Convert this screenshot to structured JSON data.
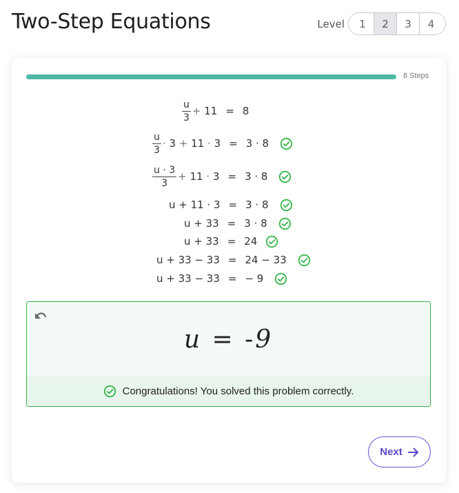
{
  "header": {
    "title": "Two-Step Equations",
    "level_label": "Level",
    "levels": [
      "1",
      "2",
      "3",
      "4"
    ],
    "selected_level": "2"
  },
  "progress": {
    "fraction": 1.0,
    "label": "8 Steps",
    "color": "#4fb8a6"
  },
  "steps": [
    {
      "lhs": "u/3 + 11",
      "rhs": "8",
      "checked": false
    },
    {
      "lhs": "u/3 · 3 + 11 · 3",
      "rhs": "3 · 8",
      "checked": true
    },
    {
      "lhs": "(u · 3)/3 + 11 · 3",
      "rhs": "3 · 8",
      "checked": true
    },
    {
      "lhs": "u + 11 · 3",
      "rhs": "3 · 8",
      "checked": true
    },
    {
      "lhs": "u + 33",
      "rhs": "3 · 8",
      "checked": true
    },
    {
      "lhs": "u + 33",
      "rhs": "24",
      "checked": true
    },
    {
      "lhs": "u + 33 − 33",
      "rhs": "24 − 33",
      "checked": true
    },
    {
      "lhs": "u + 33 − 33",
      "rhs": "− 9",
      "checked": true
    }
  ],
  "tokens": {
    "u": "u",
    "three": "3",
    "plus": "+",
    "minus": "−",
    "dot": "·",
    "eq": "=",
    "eleven": "11",
    "eight": "8",
    "thirtythree": "33",
    "twentyfour": "24",
    "nine": "9",
    "u_dot_3": "u · 3"
  },
  "answer": {
    "handwritten": "u = -9",
    "feedback": "Congratulations! You solved this problem correctly.",
    "success_color": "#37b24d"
  },
  "footer": {
    "next_label": "Next",
    "accent": "#5b45c9"
  }
}
